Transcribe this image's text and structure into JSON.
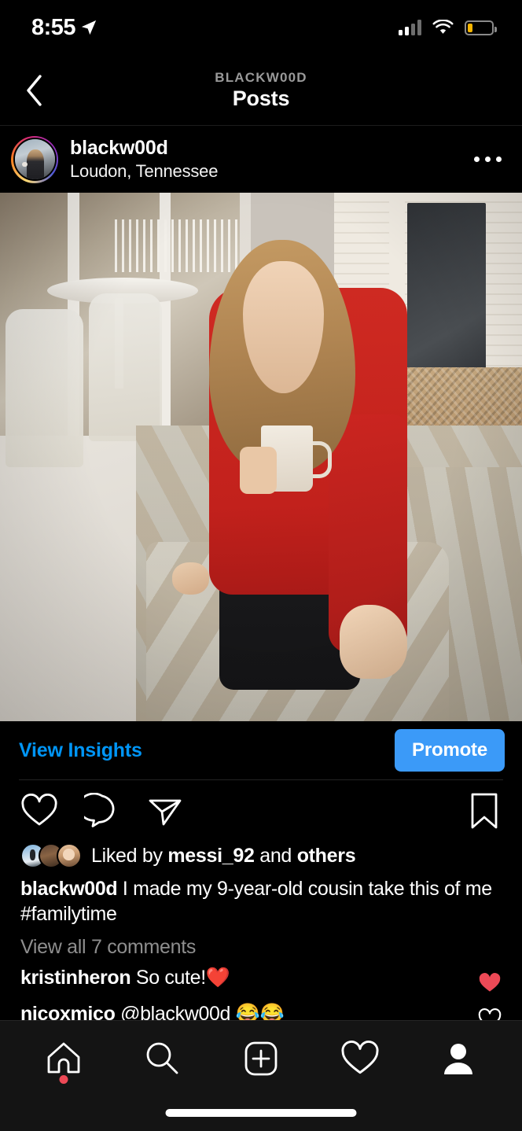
{
  "status_bar": {
    "time": "8:55",
    "location_arrow_icon": "location-arrow-icon",
    "cellular_icon": "cellular-signal-icon",
    "cellular_bars_filled": 2,
    "cellular_bars_total": 4,
    "wifi_icon": "wifi-icon",
    "battery_icon": "battery-icon",
    "battery_percent": 22,
    "battery_color": "#F7B500"
  },
  "nav_header": {
    "back_icon": "back-chevron-icon",
    "eyebrow": "BLACKW00D",
    "title": "Posts"
  },
  "post_header": {
    "avatar_icon": "profile-avatar",
    "username": "blackw00d",
    "location": "Loudon, Tennessee",
    "more_icon": "more-options-icon"
  },
  "photo": {
    "alt": "Woman in red sweater sitting on patio sofa holding a mug"
  },
  "insights": {
    "view_insights_label": "View Insights",
    "view_insights_color": "#0095F6",
    "promote_label": "Promote",
    "promote_bg": "#3B9AF8"
  },
  "actions": {
    "like_icon": "heart-icon",
    "comment_icon": "comment-icon",
    "share_icon": "share-paper-plane-icon",
    "save_icon": "bookmark-icon"
  },
  "likes": {
    "prefix": "Liked by ",
    "user": "messi_92",
    "middle": " and ",
    "suffix": "others"
  },
  "caption": {
    "username": "blackw00d",
    "text": " I made my 9-year-old cousin take this of me #familytime"
  },
  "comments": {
    "view_all_label": "View all 7 comments",
    "items": [
      {
        "username": "kristinheron",
        "text": " So cute!❤️",
        "liked": true,
        "heart_icon": "heart-filled-icon",
        "heart_color": "#ED4956"
      },
      {
        "username": "nicoxmico",
        "text": " @blackw00d 😂😂",
        "liked": false,
        "heart_icon": "heart-outline-icon",
        "heart_color": "#ffffff"
      }
    ]
  },
  "tab_bar": {
    "items": [
      {
        "name": "home",
        "icon": "home-icon",
        "badge": true,
        "badge_color": "#ED4956"
      },
      {
        "name": "search",
        "icon": "search-icon",
        "badge": false
      },
      {
        "name": "create",
        "icon": "plus-square-icon",
        "badge": false
      },
      {
        "name": "activity",
        "icon": "heart-icon",
        "badge": false
      },
      {
        "name": "profile",
        "icon": "person-icon",
        "badge": false
      }
    ],
    "home_indicator": "home-indicator-bar"
  }
}
